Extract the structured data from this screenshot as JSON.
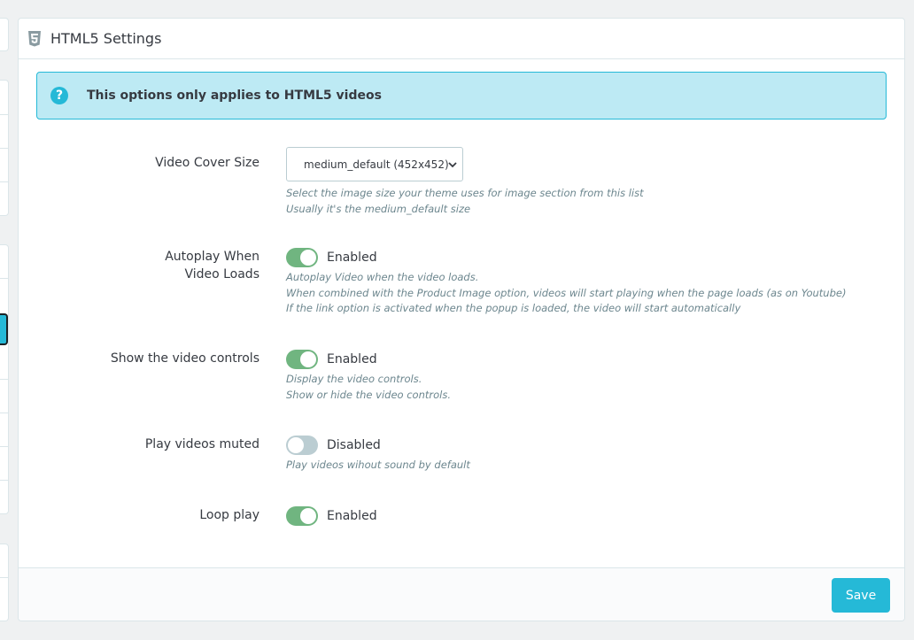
{
  "panel": {
    "title": "HTML5 Settings",
    "icon": "html5-icon"
  },
  "alert": {
    "icon": "question-circle-icon",
    "text": "This options only applies to HTML5 videos"
  },
  "fields": {
    "cover_size": {
      "label": "Video Cover Size",
      "value": "medium_default (452x452)",
      "help": [
        "Select the image size your theme uses for image section from this list",
        "Usually it's the medium_default size"
      ]
    },
    "autoplay": {
      "label": "Autoplay When Video Loads",
      "state": "Enabled",
      "on": true,
      "help": [
        "Autoplay Video when the video loads.",
        "When combined with the Product Image option, videos will start playing when the page loads (as on Youtube)",
        "If the link option is activated when the popup is loaded, the video will start automatically"
      ]
    },
    "controls": {
      "label": "Show the video controls",
      "state": "Enabled",
      "on": true,
      "help": [
        "Display the video controls.",
        "Show or hide the video controls."
      ]
    },
    "muted": {
      "label": "Play videos muted",
      "state": "Disabled",
      "on": false,
      "help": [
        "Play videos wihout sound by default"
      ]
    },
    "loop": {
      "label": "Loop play",
      "state": "Enabled",
      "on": true
    }
  },
  "footer": {
    "save_label": "Save"
  },
  "colors": {
    "accent": "#25b9d7",
    "toggle_on": "#70b580",
    "toggle_off": "#bbcdd2",
    "alert_bg": "#bdeaf4"
  }
}
